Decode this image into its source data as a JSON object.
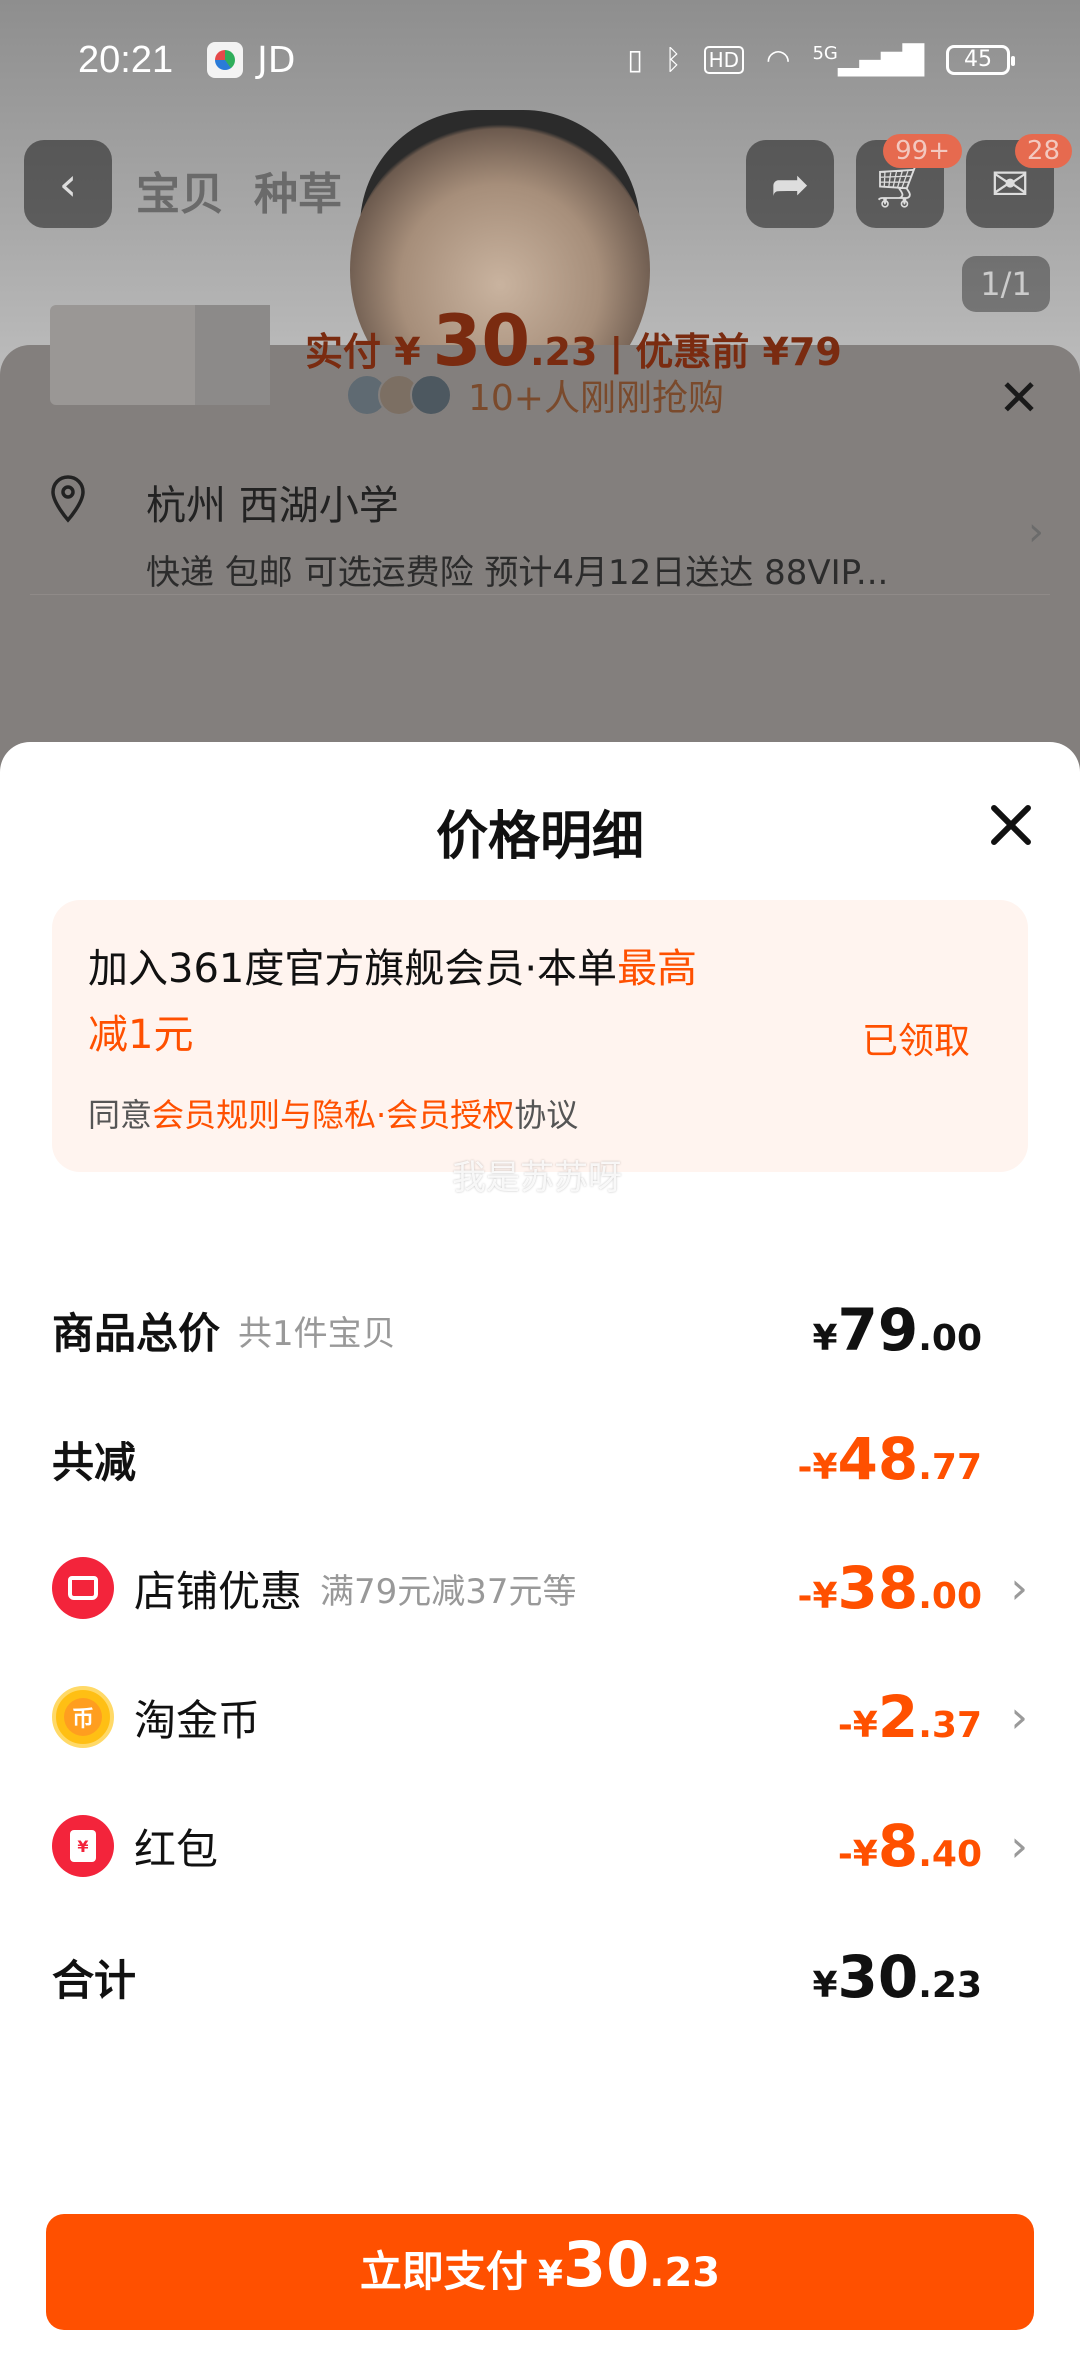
{
  "status_bar": {
    "time": "20:21",
    "app_label": "JD",
    "network": "5G",
    "battery": "45",
    "icons": [
      "vibrate-icon",
      "bluetooth-icon",
      "hd-icon",
      "wifi-icon",
      "signal-icon",
      "battery-icon"
    ]
  },
  "background_page": {
    "nav_tabs": [
      "宝贝",
      "种草"
    ],
    "cart_badge": "99+",
    "message_badge": "28",
    "image_counter": "1/1",
    "buyers_text": "10+人刚刚抢购",
    "address_title": "杭州 西湖小学",
    "address_sub": "快递 包邮 可选运费险 预计4月12日送达 88VIP...",
    "price_prefix": "实付 ¥",
    "price_int": "30",
    "price_dec": ".23",
    "price_before": "优惠前 ¥79"
  },
  "sheet": {
    "title": "价格明细",
    "member": {
      "text_normal": "加入361度官方旗舰会员·本单",
      "text_highlight_1": "最高",
      "text_highlight_2": "减1元",
      "claimed": "已领取",
      "agree_prefix": "同意",
      "agree_link": "会员规则与隐私·会员授权",
      "agree_suffix": "协议",
      "watermark": "我是苏苏呀"
    },
    "rows": {
      "total_goods": {
        "label": "商品总价",
        "sub": "共1件宝贝",
        "sym": "¥",
        "int": "79",
        "dec": ".00"
      },
      "total_reduce": {
        "label": "共减",
        "sym": "-¥",
        "int": "48",
        "dec": ".77"
      },
      "shop_discount": {
        "label": "店铺优惠",
        "sub": "满79元减37元等",
        "sym": "-¥",
        "int": "38",
        "dec": ".00"
      },
      "tao_coin": {
        "label": "淘金币",
        "icon_text": "币",
        "sym": "-¥",
        "int": "2",
        "dec": ".37"
      },
      "red_packet": {
        "label": "红包",
        "icon_text": "¥",
        "sym": "-¥",
        "int": "8",
        "dec": ".40"
      },
      "sum": {
        "label": "合计",
        "sym": "¥",
        "int": "30",
        "dec": ".23"
      }
    },
    "pay_button": {
      "label": "立即支付",
      "sym": "¥",
      "int": "30",
      "dec": ".23"
    }
  },
  "colors": {
    "accent": "#ff5000",
    "shop_red": "#f3243b",
    "coin_gold": "#ffbf14"
  }
}
